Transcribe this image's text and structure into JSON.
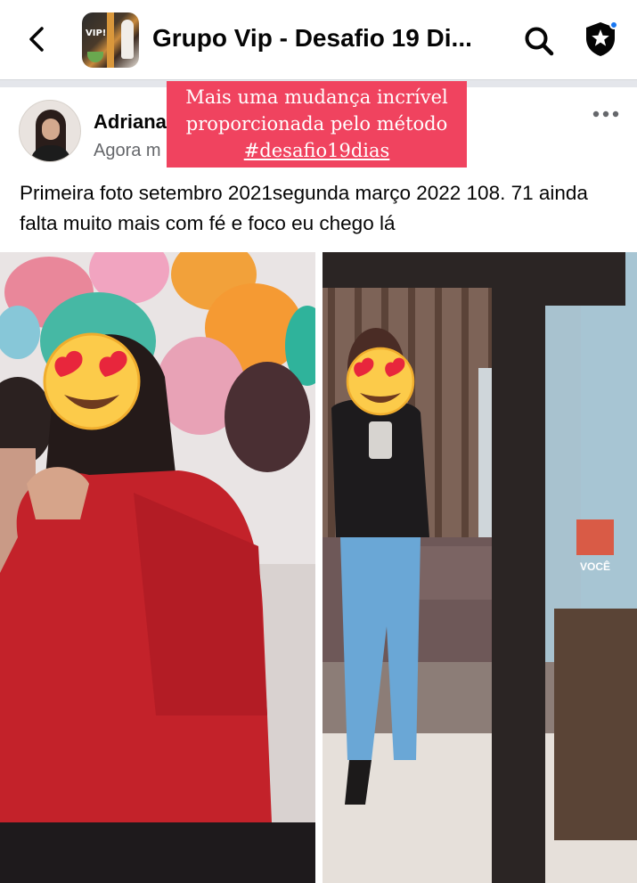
{
  "header": {
    "title": "Grupo Vip - Desafio 19 Di...",
    "back_icon": "back-arrow-icon",
    "search_icon": "search-icon",
    "shield_icon": "shield-star-icon",
    "thumbnail_label": "VIP!"
  },
  "post": {
    "author": "Adriana",
    "time": "Agora m",
    "text": "Primeira foto setembro 2021segunda março 2022 108. 71 ainda falta muito mais com fé e foco eu chego lá",
    "more_icon": "more-options-icon"
  },
  "overlay": {
    "line1": "Mais uma mudança incrível",
    "line2": "proporcionada pelo método",
    "hashtag": "#desafio19dias",
    "color": "#f0435f"
  },
  "photos": {
    "right_sign": "VOCÊ"
  },
  "colors": {
    "accent": "#1877f2",
    "secondary_text": "#65676b",
    "divider": "#e4e6eb"
  }
}
